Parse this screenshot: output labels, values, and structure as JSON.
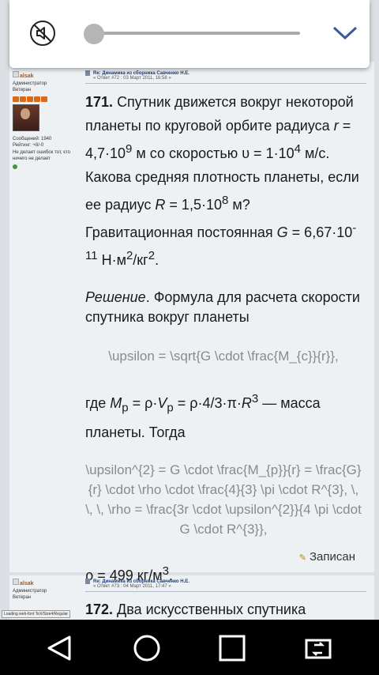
{
  "post1": {
    "author": "alsak",
    "role": "Администратор",
    "rank": "Ветеран",
    "messages": "Сообщений: 1940",
    "rating": "Рейтинг: +8/-0",
    "motto_line1": "Не делает ошибок тот, кто",
    "motto_line2": "ничего не делает",
    "subject": "Re: Динамика из сборника Савченко Н.Е.",
    "meta": "« Ответ #72 : 03 Март 2011, 16:58 »",
    "problem_number": "171.",
    "p1": "Спутник движется вокруг некоторой планеты по круговой орбите радиуса",
    "p1_var_r": "r",
    "p1_eq_r": " = 4,7·10",
    "p1_exp_r": "9",
    "p1_after_r": " м со скоростью υ = 1·10",
    "p1_exp_v": "4",
    "p1_after_v": " м/с. Какова средняя плотность планеты, если ее радиус",
    "p1_var_R": "R",
    "p1_eq_R": " = 1,5·10",
    "p1_exp_R": "8",
    "p1_after_R": " м? Гравитационная постоянная",
    "p1_var_G": "G",
    "p1_eq_G": " = 6,67·10",
    "p1_exp_G": "-11",
    "p1_units": " Н·м",
    "p1_units_exp": "2",
    "p1_units2": "/кг",
    "p1_units2_exp": "2",
    "p1_end": ".",
    "solution_label": "Решение",
    "solution_text": ". Формула для расчета скорости спутника вокруг планеты",
    "formula1": "\\upsilon = \\sqrt{G \\cdot \\frac{M_{c}}{r}},",
    "where_text": "где ",
    "where_M": "M",
    "where_p": "p",
    "where_eq": " = ρ·",
    "where_V": "V",
    "where_p2": "p",
    "where_rest": " = ρ·4/3·π·",
    "where_R": "R",
    "where_exp3": "3",
    "where_end": " — масса планеты. Тогда",
    "formula2": "\\upsilon^{2} = G \\cdot \\frac{M_{p}}{r} = \\frac{G}{r} \\cdot \\rho \\cdot \\frac{4}{3} \\pi \\cdot R^{3}, \\, \\, \\, \\rho = \\frac{3r \\cdot \\upsilon^{2}}{4 \\pi \\cdot G \\cdot R^{3}},",
    "answer": "ρ = 499 кг/м",
    "answer_exp": "3",
    "answer_end": ".",
    "recorded": "Записан"
  },
  "post2": {
    "author": "alsak",
    "role": "Администратор",
    "rank": "Ветеран",
    "subject": "Re: Динамика из сборника Савченко Н.Е.",
    "meta": "« Ответ #73 : 04 Март 2011, 17:47 »",
    "problem_number": "172.",
    "text": " Два искусственных спутника"
  },
  "loading": "Loading web-font TeX/Size4/Regular",
  "volume": {
    "level": 0.0,
    "muted": true
  },
  "colors": {
    "accent": "#1e3c78",
    "username": "#b5530a",
    "star": "#d86a1a"
  }
}
